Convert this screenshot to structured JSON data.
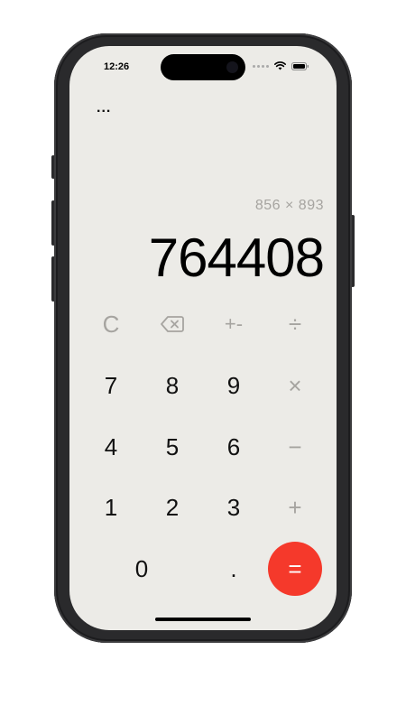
{
  "status_bar": {
    "time": "12:26"
  },
  "header": {
    "menu_label": "..."
  },
  "display": {
    "expression": "856 × 893",
    "result": "764408"
  },
  "keys": {
    "clear": "C",
    "backspace_icon": "backspace-icon",
    "plus_minus": "+-",
    "divide": "÷",
    "seven": "7",
    "eight": "8",
    "nine": "9",
    "multiply": "×",
    "four": "4",
    "five": "5",
    "six": "6",
    "minus": "−",
    "one": "1",
    "two": "2",
    "three": "3",
    "plus": "+",
    "zero": "0",
    "decimal": ".",
    "equals": "="
  },
  "colors": {
    "background": "#ecebe7",
    "muted_text": "#a6a4a0",
    "accent": "#f5392b"
  }
}
